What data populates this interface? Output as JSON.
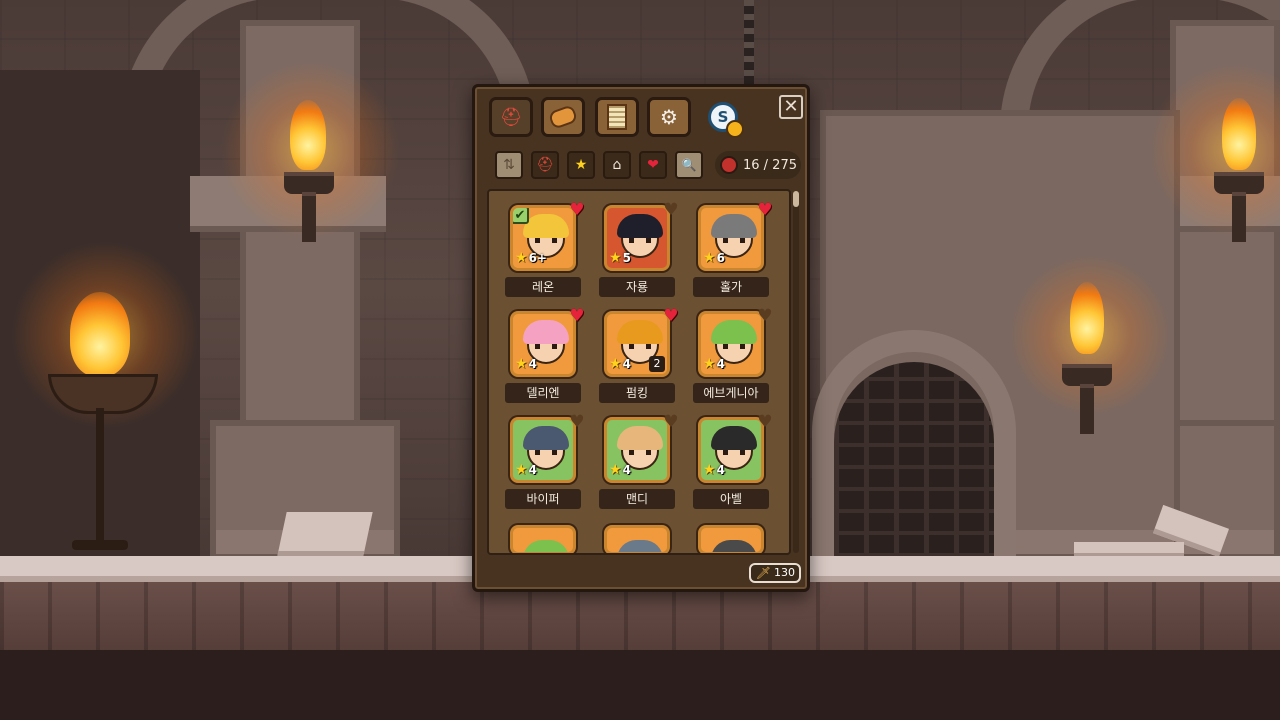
{
  "tabs": [
    {
      "name": "characters",
      "icon": "helmet-icon",
      "glyph": "⛑",
      "active": true
    },
    {
      "name": "items",
      "icon": "bread-icon",
      "glyph": "🥖",
      "active": false
    },
    {
      "name": "notes",
      "icon": "scroll-icon",
      "glyph": "📜",
      "active": false
    },
    {
      "name": "settings",
      "icon": "gear-icon",
      "glyph": "⚙",
      "active": false
    },
    {
      "name": "steam",
      "icon": "steam-icon",
      "glyph": "S",
      "active": false
    }
  ],
  "close_glyph": "✕",
  "filters": [
    {
      "name": "sort",
      "glyph": "⇅"
    },
    {
      "name": "character-type",
      "glyph": "⛑"
    },
    {
      "name": "favorite-star",
      "glyph": "★"
    },
    {
      "name": "costume",
      "glyph": "⌂"
    },
    {
      "name": "like-heart",
      "glyph": "❤"
    },
    {
      "name": "search",
      "glyph": "🔍"
    }
  ],
  "collection_count": "16 / 275",
  "characters": [
    {
      "name": "레온",
      "rank": "6+",
      "liked": true,
      "selected": true,
      "portrait": "orange",
      "hair": "#f2c53a"
    },
    {
      "name": "자룡",
      "rank": "5",
      "liked": false,
      "selected": false,
      "portrait": "red",
      "hair": "#1f1f2b"
    },
    {
      "name": "홀가",
      "rank": "6",
      "liked": true,
      "selected": false,
      "portrait": "orange",
      "hair": "#7a7a7a"
    },
    {
      "name": "델리엔",
      "rank": "4",
      "liked": true,
      "selected": false,
      "portrait": "orange",
      "hair": "#f5a2c2"
    },
    {
      "name": "펌킹",
      "rank": "4",
      "liked": true,
      "selected": false,
      "portrait": "orange",
      "hair": "#e89a1e",
      "duplicates": "2"
    },
    {
      "name": "에브게니아",
      "rank": "4",
      "liked": false,
      "selected": false,
      "portrait": "orange",
      "hair": "#7cc04e"
    },
    {
      "name": "바이퍼",
      "rank": "4",
      "liked": false,
      "selected": false,
      "portrait": "green",
      "hair": "#4a5870"
    },
    {
      "name": "맨디",
      "rank": "4",
      "liked": false,
      "selected": false,
      "portrait": "green",
      "hair": "#e7b67a"
    },
    {
      "name": "아벨",
      "rank": "4",
      "liked": false,
      "selected": false,
      "portrait": "green",
      "hair": "#2a2a2a"
    }
  ],
  "currency": {
    "icon": "sword-icon",
    "value": "130"
  },
  "colors": {
    "panel": "#47331f",
    "tab": "#8a6238",
    "heart_on": "#e5243b",
    "star": "#ffd21e"
  }
}
